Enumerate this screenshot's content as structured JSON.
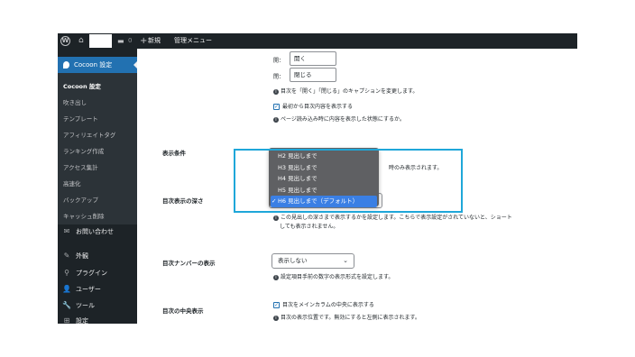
{
  "adminbar": {
    "wp_logo": "W",
    "home_icon": "⌂",
    "comment_icon": "▬",
    "comment_count": "0",
    "new_label": "新規",
    "menu_label": "管理メニュー"
  },
  "sidebar": {
    "current_label": "Cocoon 設定",
    "submenu": [
      "Cocoon 設定",
      "吹き出し",
      "テンプレート",
      "アフィリエイトタグ",
      "ランキング作成",
      "アクセス集計",
      "高速化",
      "バックアップ",
      "キャッシュ削除"
    ],
    "menu": [
      {
        "icon": "✉",
        "label": "お問い合わせ"
      },
      {
        "icon": "✎",
        "label": "外観"
      },
      {
        "icon": "⚲",
        "label": "プラグイン"
      },
      {
        "icon": "👤",
        "label": "ユーザー"
      },
      {
        "icon": "🔧",
        "label": "ツール"
      },
      {
        "icon": "⊞",
        "label": "設定"
      }
    ]
  },
  "main": {
    "open_label": "開：",
    "open_value": "開く",
    "close_label": "閉：",
    "close_value": "閉じる",
    "caption_note": "目次を「開く」「閉じる」のキャプションを変更します。",
    "show_content_label": "最初から目次内容を表示する",
    "show_content_note": "ページ読み込み時に内容を表示した状態にするか。",
    "display_condition_label": "表示条件",
    "display_condition_note": "時のみ表示されます。",
    "depth_label": "目次表示の深さ",
    "depth_note_1": "この見出しの深さまで表示するかを設定します。こちらで表示設定がされていないと、ショート",
    "depth_note_2": "しても表示されません。",
    "number_label": "目次ナンバーの表示",
    "number_select": "表示しない",
    "number_note": "設定項目手前の数字の表示形式を設定します。",
    "center_label": "目次の中央表示",
    "center_checkbox_label": "目次をメインカラムの中央に表示する",
    "center_note": "目次の表示位置です。無効にすると左側に表示されます。"
  },
  "dropdown": {
    "options": [
      "H2 見出しまで",
      "H3 見出しまで",
      "H4 見出しまで",
      "H5 見出しまで",
      "H6 見出しまで（デフォルト）"
    ],
    "selected": "H6 見出しまで（デフォルト）",
    "check": "✓"
  },
  "colors": {
    "admin_dark": "#1d2327",
    "accent_blue": "#2271b1",
    "highlight_border": "#1fa7d9",
    "dropdown_bg": "#5f6063",
    "dropdown_selected": "#3a7fe4"
  }
}
